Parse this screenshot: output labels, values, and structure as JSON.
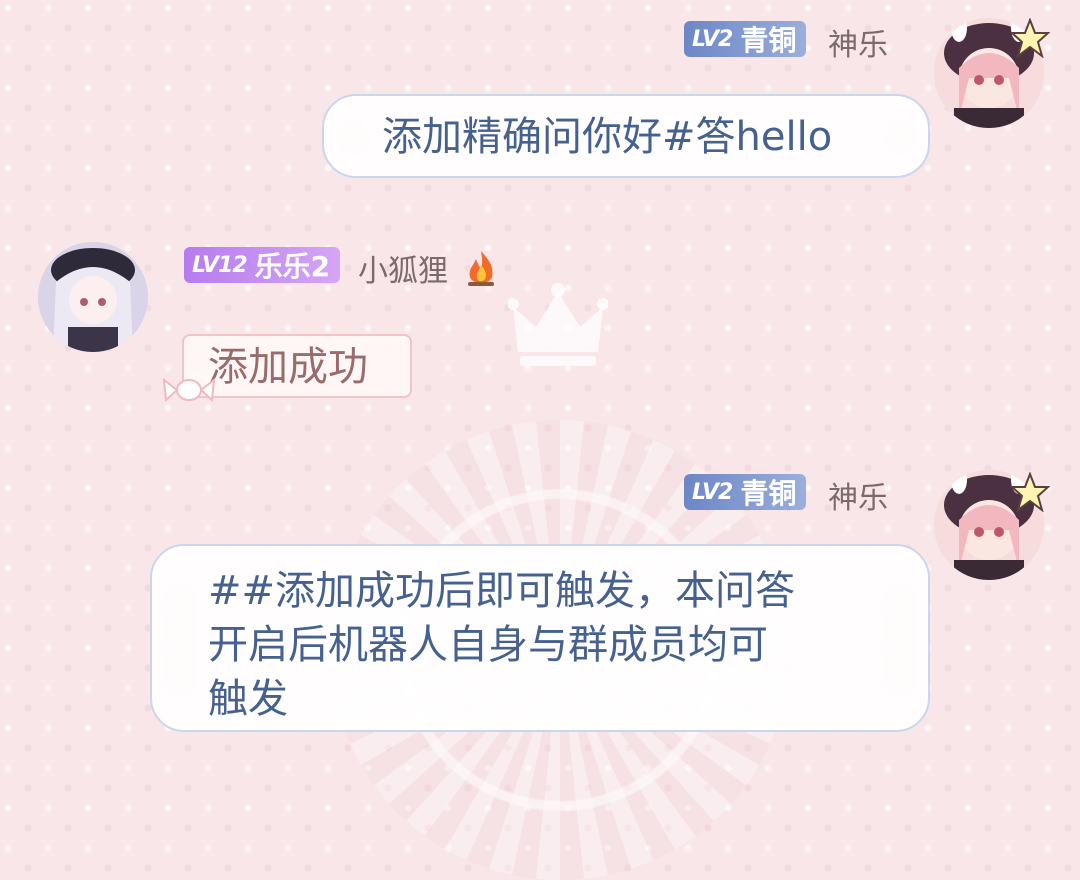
{
  "messages": [
    {
      "side": "right",
      "badge": {
        "level": "LV2",
        "title": "青铜"
      },
      "nickname": "神乐",
      "text": "添加精确问你好#答hello"
    },
    {
      "side": "left",
      "badge": {
        "level": "LV12",
        "title": "乐乐2"
      },
      "nickname": "小狐狸",
      "status_icon": "fire-icon",
      "text": "添加成功"
    },
    {
      "side": "right",
      "badge": {
        "level": "LV2",
        "title": "青铜"
      },
      "nickname": "神乐",
      "text_lines": [
        "##添加成功后即可触发，本问答",
        "开启后机器人自身与群成员均可",
        "触发"
      ]
    }
  ],
  "colors": {
    "background": "#f8e6e9",
    "badge_blue": "#7b93cf",
    "badge_purple": "#c58ff3",
    "bubble_text": "#45618f",
    "reply_text": "#9a6b6b"
  }
}
